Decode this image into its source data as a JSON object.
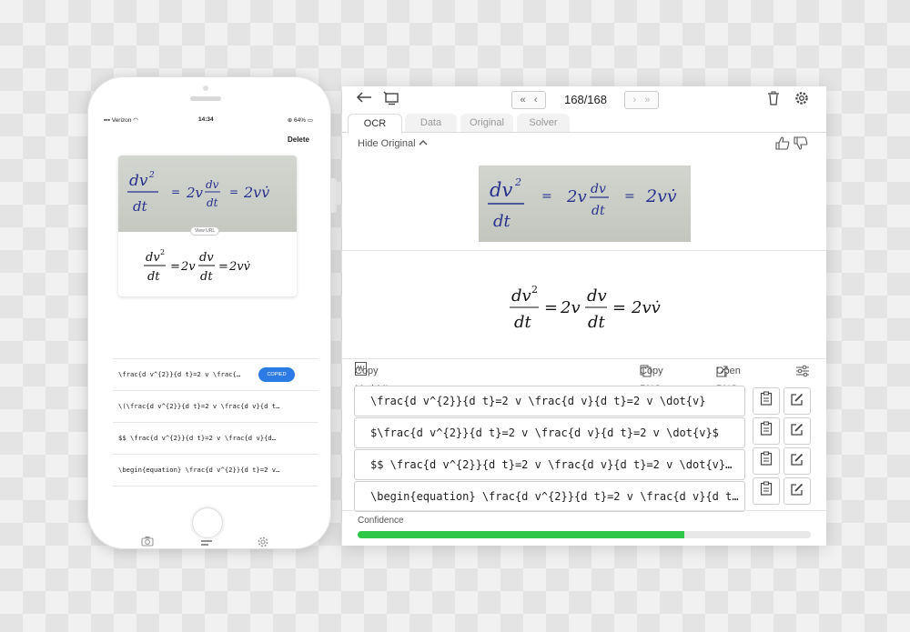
{
  "colors": {
    "accent_blue": "#2c7be5",
    "confidence_green": "#2ec748",
    "ink": "#28318d"
  },
  "phone": {
    "status": {
      "carrier": "Verizon",
      "time": "14:34",
      "battery": "64%"
    },
    "delete_label": "Delete",
    "view_url_label": "View URL",
    "copied_label": "COPIED",
    "results": [
      "\\frac{d v^{2}}{d t}=2 v \\frac{…",
      "\\(\\frac{d v^{2}}{d t}=2 v \\frac{d v}{d t…",
      "$$ \\frac{d v^{2}}{d t}=2 v \\frac{d v}{d…",
      "\\begin{equation} \\frac{d v^{2}}{d t}=2 v…"
    ],
    "nav_icons": [
      "camera-icon",
      "list-icon",
      "gear-icon"
    ]
  },
  "window": {
    "pager": {
      "first": "«",
      "prev": "‹",
      "text": "168/168",
      "next": "›",
      "last": "»"
    },
    "tabs": [
      {
        "label": "OCR",
        "active": true
      },
      {
        "label": "Data",
        "active": false
      },
      {
        "label": "Original",
        "active": false
      },
      {
        "label": "Solver",
        "active": false
      }
    ],
    "hide_original_label": "Hide Original",
    "actions": {
      "copy_mathml": "Copy MathML",
      "copy_png": "Copy PNG",
      "open_png": "Open PNG"
    },
    "formats": [
      "\\frac{d v^{2}}{d t}=2 v \\frac{d v}{d t}=2 v \\dot{v}",
      "$\\frac{d v^{2}}{d t}=2 v \\frac{d v}{d t}=2 v \\dot{v}$",
      "$$ \\frac{d v^{2}}{d t}=2 v \\frac{d v}{d t}=2 v \\dot{v}…",
      "\\begin{equation} \\frac{d v^{2}}{d t}=2 v \\frac{d v}{d t…"
    ],
    "confidence_label": "Confidence",
    "confidence_value": 0.72
  }
}
